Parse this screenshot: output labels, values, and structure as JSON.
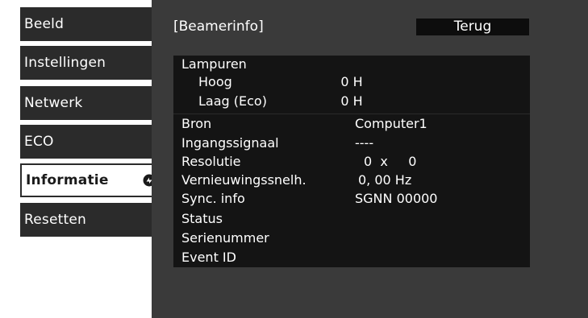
{
  "menu": {
    "items": [
      {
        "label": "Beeld"
      },
      {
        "label": "Instellingen"
      },
      {
        "label": "Netwerk"
      },
      {
        "label": "ECO"
      },
      {
        "label": "Informatie"
      },
      {
        "label": "Resetten"
      }
    ],
    "selected": "Informatie"
  },
  "panel": {
    "title": "[Beamerinfo]",
    "back_label": "Terug"
  },
  "info": {
    "rows": [
      {
        "label": "Lampuren",
        "value": ""
      },
      {
        "label": "Hoog",
        "value": "0 H"
      },
      {
        "label": "Laag (Eco)",
        "value": "0 H"
      },
      {
        "label": "Bron",
        "value": "Computer1"
      },
      {
        "label": "Ingangssignaal",
        "value": "----"
      },
      {
        "label": "Resolutie",
        "value": "0  x     0"
      },
      {
        "label": "Vernieuwingssnelh.",
        "value": "0, 00 Hz"
      },
      {
        "label": "Sync. info",
        "value": "SGNN 00000"
      },
      {
        "label": "Status",
        "value": ""
      },
      {
        "label": "Serienummer",
        "value": ""
      },
      {
        "label": "Event ID",
        "value": ""
      }
    ]
  },
  "colors": {
    "panel_bg": "#3a3a3a",
    "menu_bg": "#2b2b2b",
    "table_bg": "#141414",
    "selected_bg": "#ffffff"
  },
  "icons": {
    "selected_pointer": "circle-arrow-icon"
  }
}
